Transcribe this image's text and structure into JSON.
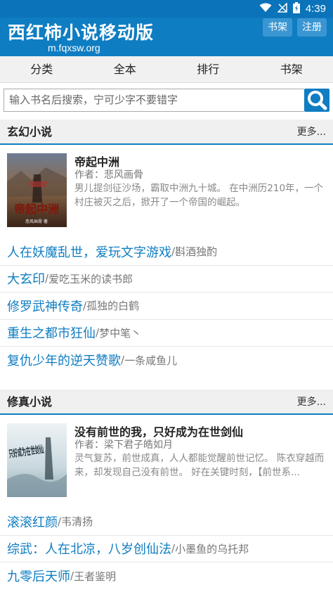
{
  "status_bar": {
    "time": "4:39"
  },
  "header": {
    "title": "西红柿小说移动版",
    "domain": "m.fqxsw.org",
    "shelf_button": "书架",
    "register_button": "注册"
  },
  "nav": {
    "items": [
      "分类",
      "全本",
      "排行",
      "书架"
    ]
  },
  "search": {
    "placeholder": "输入书名后搜索，宁可少字不要错字"
  },
  "sections": [
    {
      "title": "玄幻小说",
      "more": "更多...",
      "featured": {
        "title": "帝起中洲",
        "author": "作者：悲风画骨",
        "description": "男儿提剑征沙场，霸取中洲九十城。 在中洲历210年，一个村庄被灭之后，掀开了一个帝国的崛起。",
        "cover_text": "帝起中洲",
        "cover_sub": "悲风画骨 著"
      },
      "books": [
        {
          "name": "人在妖魔乱世，爱玩文字游戏",
          "author": "斟酒独酌"
        },
        {
          "name": "大玄印",
          "author": "爱吃玉米的读书郎"
        },
        {
          "name": "修罗武神传奇",
          "author": "孤独的白鹤"
        },
        {
          "name": "重生之都市狂仙",
          "author": "梦中笔丶"
        },
        {
          "name": "复仇少年的逆天赞歌",
          "author": "一条咸鱼儿"
        }
      ]
    },
    {
      "title": "修真小说",
      "more": "更多...",
      "featured": {
        "title": "没有前世的我，只好成为在世剑仙",
        "author": "作者：梁下君子皓如月",
        "description": "灵气复苏，前世成真，人人都能觉醒前世记忆。 陈衣穿越而来，却发现自己没有前世。 好在关键时刻，【前世系...",
        "cover_text": "只好成为在世剑仙"
      },
      "books": [
        {
          "name": "滚滚红颜",
          "author": "韦清扬"
        },
        {
          "name": "综武：人在北凉，八岁创仙法",
          "author": "小墨鱼的乌托邦"
        },
        {
          "name": "九零后天师",
          "author": "王者鉴明"
        }
      ]
    }
  ],
  "colors": {
    "brand": "#0f7dc2",
    "link": "#0f7dc2",
    "muted": "#777777"
  }
}
